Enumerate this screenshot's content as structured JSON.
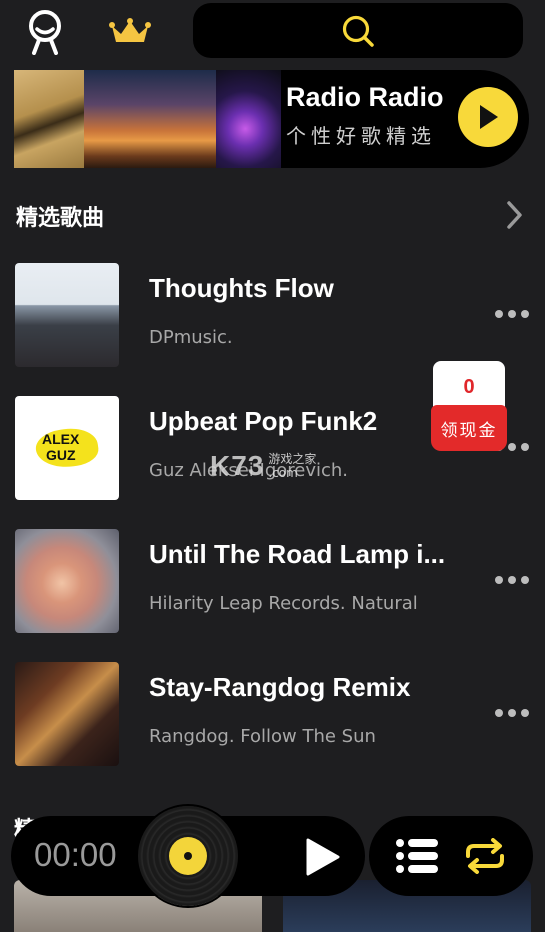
{
  "header": {
    "profile_icon": "person-outline-icon",
    "vip_icon": "crown-icon",
    "search_icon": "search-icon",
    "accent": "#f8d93a"
  },
  "banner": {
    "title": "Radio Radio",
    "subtitle": "个性好歌精选",
    "play_icon": "play-icon"
  },
  "section": {
    "title": "精选歌曲",
    "arrow_icon": "chevron-right-icon"
  },
  "songs": [
    {
      "title": "Thoughts Flow",
      "artist": "DPmusic."
    },
    {
      "title": "Upbeat Pop Funk2",
      "artist": "Guz Aleksei Igorevich."
    },
    {
      "title": "Until The Road Lamp i...",
      "artist": "Hilarity Leap Records.  Natural"
    },
    {
      "title": "Stay-Rangdog Remix",
      "artist": "Rangdog.  Follow The Sun"
    }
  ],
  "cover_logo": {
    "line1": "ALEX",
    "line2": "GUZ"
  },
  "cash_badge": {
    "amount": "0",
    "label": "领现金"
  },
  "watermark": {
    "logo": "K73",
    "line1": "游戏之家",
    "line2": ".com"
  },
  "next_section": {
    "title": "精"
  },
  "player": {
    "time": "00:00",
    "play_icon": "play-icon",
    "playlist_icon": "playlist-icon",
    "repeat_icon": "repeat-icon"
  }
}
